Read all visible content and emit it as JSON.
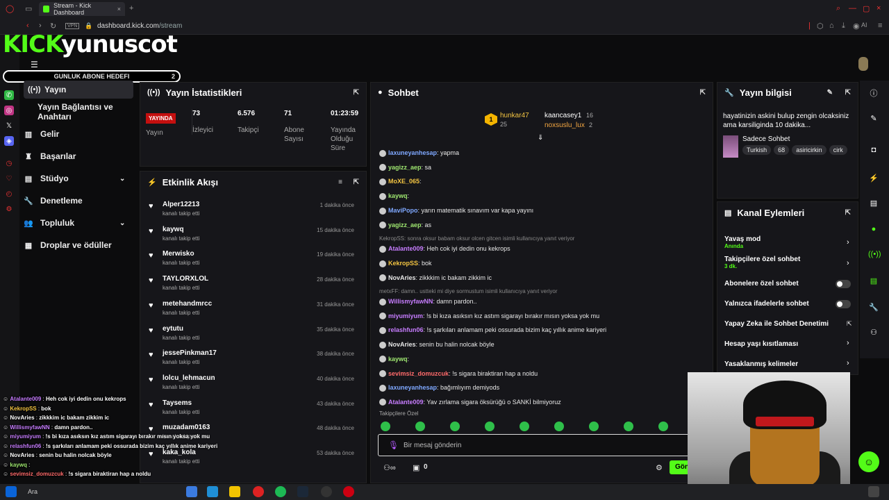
{
  "browser": {
    "tab_title": "Stream - Kick Dashboard",
    "url_host": "dashboard.kick.com",
    "url_path": "/stream",
    "vpn": "VPN",
    "ai": "AI"
  },
  "overlay_logo": {
    "kick": "KICK",
    "name": "yunuscot"
  },
  "goal": {
    "label": "GUNLUK ABONE HEDEFI",
    "count": "2"
  },
  "nav": {
    "items": [
      {
        "label": "Yayın",
        "icon": "broadcast-icon"
      },
      {
        "label": "Yayın Bağlantısı ve Anahtarı"
      },
      {
        "label": "Gelir",
        "icon": "chart-icon"
      },
      {
        "label": "Başarılar",
        "icon": "trophy-icon"
      },
      {
        "label": "Stüdyo",
        "icon": "studio-icon"
      },
      {
        "label": "Denetleme",
        "icon": "wrench-icon"
      },
      {
        "label": "Topluluk",
        "icon": "people-icon"
      },
      {
        "label": "Droplar ve ödüller",
        "icon": "gift-icon"
      }
    ]
  },
  "stats": {
    "title": "Yayın İstatistikleri",
    "live": "YAYINDA",
    "live_label": "Yayın",
    "viewers": "73",
    "viewers_label": "İzleyici",
    "followers": "6.576",
    "followers_label": "Takipçi",
    "subs": "71",
    "subs_label": "Abone Sayısı",
    "uptime": "01:23:59",
    "uptime_label": "Yayında Olduğu Süre"
  },
  "activity": {
    "title": "Etkinlik Akışı",
    "items": [
      {
        "name": "Alper12213",
        "action": "kanalı takip etti",
        "time": "1 dakika önce"
      },
      {
        "name": "kaywq",
        "action": "kanalı takip etti",
        "time": "15 dakika önce"
      },
      {
        "name": "Merwisko",
        "action": "kanalı takip etti",
        "time": "19 dakika önce"
      },
      {
        "name": "TAYLORXLOL",
        "action": "kanalı takip etti",
        "time": "28 dakika önce"
      },
      {
        "name": "metehandmrcc",
        "action": "kanalı takip etti",
        "time": "31 dakika önce"
      },
      {
        "name": "eytutu",
        "action": "kanalı takip etti",
        "time": "35 dakika önce"
      },
      {
        "name": "jessePinkman17",
        "action": "kanalı takip etti",
        "time": "38 dakika önce"
      },
      {
        "name": "lolcu_lehmacun",
        "action": "kanalı takip etti",
        "time": "40 dakika önce"
      },
      {
        "name": "Taysems",
        "action": "kanalı takip etti",
        "time": "43 dakika önce"
      },
      {
        "name": "muzadam0163",
        "action": "kanalı takip etti",
        "time": "48 dakika önce"
      },
      {
        "name": "kaka_kola",
        "action": "kanalı takip etti",
        "time": "53 dakika önce"
      }
    ]
  },
  "chat": {
    "title": "Sohbet",
    "top": [
      {
        "rank": "1",
        "name": "hunkar47",
        "count": "25"
      },
      {
        "name": "kaancasey1",
        "count": "16"
      },
      {
        "name": "noxsuslu_lux",
        "count": "2"
      }
    ],
    "messages": [
      {
        "user": "laxuneyanhesap",
        "color": "#7fa8ff",
        "text": "yapma"
      },
      {
        "user": "yagizz_aep",
        "color": "#9fe870",
        "text": "sa"
      },
      {
        "user": "MoXE_065",
        "color": "#f4c542",
        "text": ""
      },
      {
        "user": "kaywq",
        "color": "#9fe870",
        "text": ""
      },
      {
        "user": "MaviPopo",
        "color": "#7fa8ff",
        "text": "yarın matematik sınavım var kapa yayını"
      },
      {
        "user": "yagizz_aep",
        "color": "#9fe870",
        "text": "as"
      },
      {
        "reply": "KekropSS: sonra oksur babam oksur olcen gitcen isimli kullanıcıya yanıt veriyor"
      },
      {
        "user": "Atalante009",
        "color": "#c77dff",
        "text": "Heh cok iyi dedin onu kekrops"
      },
      {
        "user": "KekropSS",
        "color": "#f4c542",
        "text": "bok"
      },
      {
        "user": "NovAries",
        "color": "#e8e8e8",
        "text": "zikkkim ic bakam zikkim ic"
      },
      {
        "reply": "metxFF: damn.. ustteki mi diye sormustum isimli kullanıcıya yanıt veriyor"
      },
      {
        "user": "WillismyfawNN",
        "color": "#c77dff",
        "text": "damn pardon.."
      },
      {
        "user": "miyumiyum",
        "color": "#c77dff",
        "text": "!s bi kıza asıksın kız astım sigarayı bırakır mısın yoksa yok mu"
      },
      {
        "user": "relashfun06",
        "color": "#c77dff",
        "text": "!s şarkıları anlamam peki ossurada bizim kaç yıllık anime kariyeri"
      },
      {
        "user": "NovAries",
        "color": "#e8e8e8",
        "text": "senin bu halin nolcak böyle"
      },
      {
        "user": "kaywq",
        "color": "#9fe870",
        "text": ""
      },
      {
        "user": "sevimsiz_domuzcuk",
        "color": "#ff6b6b",
        "text": "!s sigara biraktiran hap a noldu"
      },
      {
        "user": "laxuneyanhesap",
        "color": "#7fa8ff",
        "text": "bağımlıyım demiyods"
      },
      {
        "user": "Atalante009",
        "color": "#c77dff",
        "text": "Yav zırlama sigara öksürüğü o SANKİ bilmiyoruz"
      }
    ],
    "followers_only": "Takipçilere Özel",
    "input_placeholder": "Bir mesaj gönderin",
    "counter": "0",
    "send": "Gön"
  },
  "stream_info": {
    "title": "Yayın bilgisi",
    "stream_title": "hayatinizin askini bulup zengin olcaksiniz ama karsiliginda 10 dakika...",
    "category": "Sadece Sohbet",
    "tags": [
      "Turkish",
      "68",
      "asiricirkin",
      "cirk"
    ]
  },
  "channel_actions": {
    "title": "Kanal Eylemleri",
    "items": [
      {
        "label": "Yavaş mod",
        "sub": "Anında"
      },
      {
        "label": "Takipçilere özel sohbet",
        "sub": "3 dk."
      },
      {
        "label": "Abonelere özel sohbet"
      },
      {
        "label": "Yalnızca ifadelerle sohbet"
      },
      {
        "label": "Yapay Zeka ile Sohbet Denetimi"
      },
      {
        "label": "Hesap yaşı kısıtlaması"
      },
      {
        "label": "Yasaklanmış kelimeler"
      }
    ]
  },
  "overlay_chat": [
    {
      "user": "Atalante009",
      "color": "#c77dff",
      "text": "Heh cok iyi dedin onu kekrops"
    },
    {
      "user": "KekropSS",
      "color": "#f4c542",
      "text": "bok"
    },
    {
      "user": "NovAries",
      "color": "#ffffff",
      "text": "zikkkim ic bakam zikkim ic"
    },
    {
      "user": "WillismyfawNN",
      "color": "#c77dff",
      "text": "damn pardon.."
    },
    {
      "user": "miyumiyum",
      "color": "#c77dff",
      "text": "!s bi kıza asıksın kız astım sigarayı bırakır mısın yoksa yok mu"
    },
    {
      "user": "relashfun06",
      "color": "#c77dff",
      "text": "!s şarkıları anlamam peki ossurada bizim kaç yıllık anime kariyeri"
    },
    {
      "user": "NovAries",
      "color": "#ffffff",
      "text": "senin bu halin nolcak böyle"
    },
    {
      "user": "kaywq",
      "color": "#9fe870",
      "text": ""
    },
    {
      "user": "sevimsiz_domuzcuk",
      "color": "#ff6b6b",
      "text": "!s sigara biraktiran hap a noldu"
    }
  ],
  "taskbar": {
    "search": "Ara"
  },
  "colors": {
    "accent": "#53fc18",
    "live": "#c40f0f"
  }
}
